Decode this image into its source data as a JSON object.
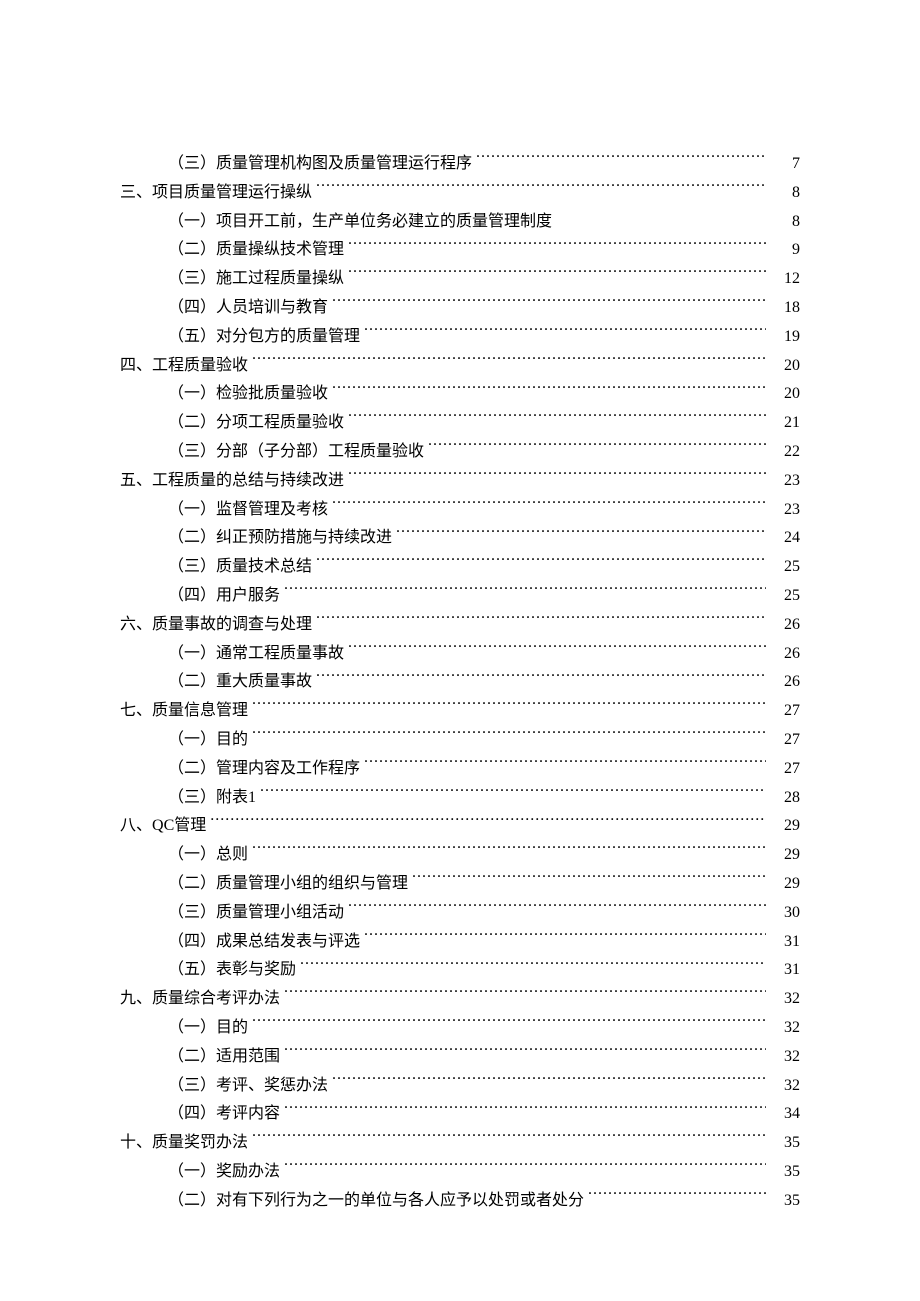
{
  "toc": [
    {
      "level": 2,
      "prefix": "（三）",
      "title": "质量管理机构图及质量管理运行程序",
      "page": "7",
      "leader": true
    },
    {
      "level": 1,
      "prefix": "三、",
      "title": "项目质量管理运行操纵",
      "page": "8",
      "leader": true
    },
    {
      "level": 2,
      "prefix": "（一）",
      "title": "项目开工前，生产单位务必建立的质量管理制度",
      "page": "8",
      "leader": false
    },
    {
      "level": 2,
      "prefix": "（二）",
      "title": "质量操纵技术管理",
      "page": "9",
      "leader": true
    },
    {
      "level": 2,
      "prefix": "（三）",
      "title": "施工过程质量操纵",
      "page": "12",
      "leader": true
    },
    {
      "level": 2,
      "prefix": "（四）",
      "title": "人员培训与教育",
      "page": "18",
      "leader": true
    },
    {
      "level": 2,
      "prefix": "（五）",
      "title": "对分包方的质量管理",
      "page": "19",
      "leader": true
    },
    {
      "level": 1,
      "prefix": "四、",
      "title": "工程质量验收",
      "page": "20",
      "leader": true
    },
    {
      "level": 2,
      "prefix": "（一）",
      "title": "检验批质量验收",
      "page": "20",
      "leader": true
    },
    {
      "level": 2,
      "prefix": "（二）",
      "title": "分项工程质量验收",
      "page": "21",
      "leader": true
    },
    {
      "level": 2,
      "prefix": "（三）",
      "title": "分部（子分部）工程质量验收",
      "page": "22",
      "leader": true
    },
    {
      "level": 1,
      "prefix": "五、",
      "title": "工程质量的总结与持续改进",
      "page": "23",
      "leader": true
    },
    {
      "level": 2,
      "prefix": "（一）",
      "title": "监督管理及考核",
      "page": "23",
      "leader": true
    },
    {
      "level": 2,
      "prefix": "（二）",
      "title": "纠正预防措施与持续改进",
      "page": "24",
      "leader": true
    },
    {
      "level": 2,
      "prefix": "（三）",
      "title": "质量技术总结",
      "page": "25",
      "leader": true
    },
    {
      "level": 2,
      "prefix": "（四）",
      "title": "用户服务",
      "page": "25",
      "leader": true
    },
    {
      "level": 1,
      "prefix": "六、",
      "title": "质量事故的调查与处理",
      "page": "26",
      "leader": true
    },
    {
      "level": 2,
      "prefix": "（一）",
      "title": "通常工程质量事故",
      "page": "26",
      "leader": true
    },
    {
      "level": 2,
      "prefix": "（二）",
      "title": "重大质量事故",
      "page": "26",
      "leader": true
    },
    {
      "level": 1,
      "prefix": "七、",
      "title": "质量信息管理",
      "page": "27",
      "leader": true
    },
    {
      "level": 2,
      "prefix": "（一）",
      "title": "目的",
      "page": "27",
      "leader": true
    },
    {
      "level": 2,
      "prefix": "（二）",
      "title": "管理内容及工作程序",
      "page": "27",
      "leader": true
    },
    {
      "level": 2,
      "prefix": "（三）",
      "title": "附表1",
      "page": "28",
      "leader": true
    },
    {
      "level": 1,
      "prefix": "八、",
      "title": "QC管理",
      "page": "29",
      "leader": true
    },
    {
      "level": 2,
      "prefix": "（一）",
      "title": "总则",
      "page": "29",
      "leader": true
    },
    {
      "level": 2,
      "prefix": "（二）",
      "title": "质量管理小组的组织与管理",
      "page": "29",
      "leader": true
    },
    {
      "level": 2,
      "prefix": "（三）",
      "title": "质量管理小组活动",
      "page": "30",
      "leader": true
    },
    {
      "level": 2,
      "prefix": "（四）",
      "title": "成果总结发表与评选",
      "page": "31",
      "leader": true
    },
    {
      "level": 2,
      "prefix": "（五）",
      "title": "表彰与奖励",
      "page": "31",
      "leader": true
    },
    {
      "level": 1,
      "prefix": "九、",
      "title": "质量综合考评办法",
      "page": "32",
      "leader": true
    },
    {
      "level": 2,
      "prefix": "（一）",
      "title": "目的",
      "page": "32",
      "leader": true
    },
    {
      "level": 2,
      "prefix": "（二）",
      "title": "适用范围",
      "page": "32",
      "leader": true
    },
    {
      "level": 2,
      "prefix": "（三）",
      "title": "考评、奖惩办法",
      "page": "32",
      "leader": true
    },
    {
      "level": 2,
      "prefix": "（四）",
      "title": "考评内容",
      "page": "34",
      "leader": true
    },
    {
      "level": 1,
      "prefix": "十、",
      "title": "质量奖罚办法",
      "page": "35",
      "leader": true
    },
    {
      "level": 2,
      "prefix": "（一）",
      "title": "奖励办法",
      "page": "35",
      "leader": true
    },
    {
      "level": 2,
      "prefix": "（二）",
      "title": "对有下列行为之一的单位与各人应予以处罚或者处分",
      "page": "35",
      "leader": true
    }
  ]
}
